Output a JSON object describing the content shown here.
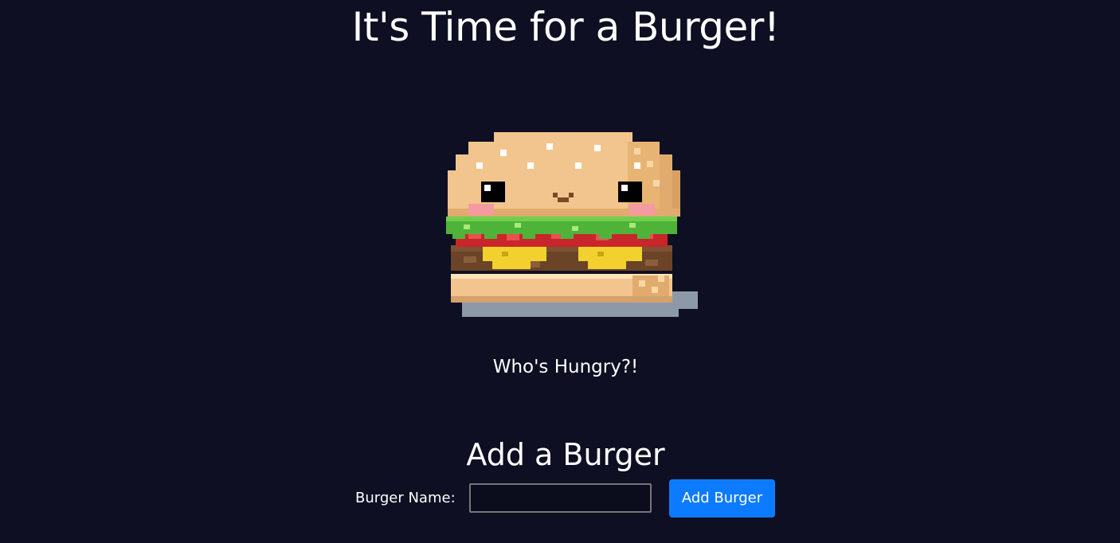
{
  "header": {
    "title": "It's Time for a Burger!"
  },
  "hero": {
    "image_icon": "pixel-burger-icon",
    "tagline": "Who's Hungry?!"
  },
  "add_form": {
    "heading": "Add a Burger",
    "name_label": "Burger Name:",
    "name_value": "",
    "button_label": "Add Burger"
  },
  "colors": {
    "background": "#0e0f22",
    "button": "#0d7bff",
    "text": "#ffffff"
  }
}
